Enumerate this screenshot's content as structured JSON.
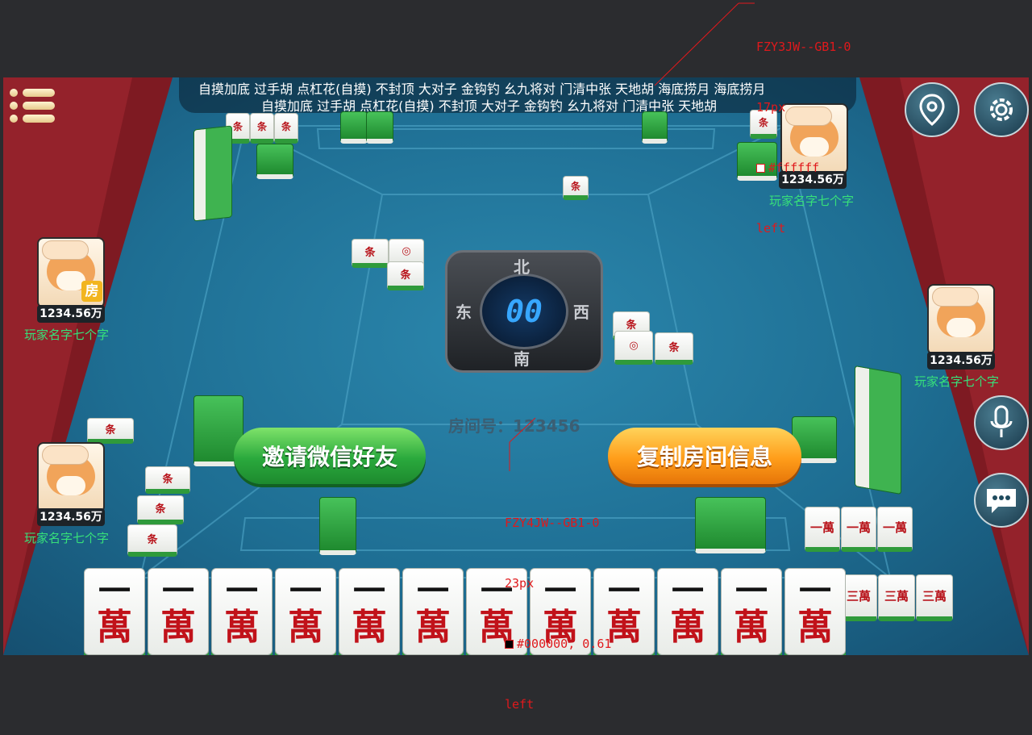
{
  "annotations": {
    "top": {
      "lines": [
        "FZY3JW--GB1-0",
        "17px",
        "#ffffff",
        "left"
      ],
      "swatch": "#ffffff"
    },
    "room": {
      "lines": [
        "FZY4JW--GB1-0",
        "23px",
        "#000000, 0.61",
        "left"
      ],
      "swatch": "#000000"
    }
  },
  "rules": {
    "line1": "自摸加底  过手胡  点杠花(自摸)  不封顶  大对子  金钩钓  幺九将对  门清中张  天地胡  海底捞月  海底捞月",
    "line2": "自摸加底  过手胡  点杠花(自摸)  不封顶  大对子  金钩钓  幺九将对  门清中张  天地胡"
  },
  "players": {
    "top_right": {
      "money": "1234.56万",
      "name": "玩家名字七个字"
    },
    "left": {
      "money": "1234.56万",
      "name": "玩家名字七个字",
      "badge": "房"
    },
    "right": {
      "money": "1234.56万",
      "name": "玩家名字七个字"
    },
    "bottom_left": {
      "money": "1234.56万",
      "name": "玩家名字七个字"
    }
  },
  "compass": {
    "timer": "00",
    "north": "北",
    "east": "东",
    "south": "南",
    "west": "西"
  },
  "room": {
    "label": "房间号：123456"
  },
  "buttons": {
    "invite": "邀请微信好友",
    "copy": "复制房间信息"
  },
  "hand": {
    "tiles": [
      {
        "n": "一",
        "w": "萬"
      },
      {
        "n": "一",
        "w": "萬"
      },
      {
        "n": "一",
        "w": "萬"
      },
      {
        "n": "一",
        "w": "萬"
      },
      {
        "n": "一",
        "w": "萬"
      },
      {
        "n": "一",
        "w": "萬"
      },
      {
        "n": "一",
        "w": "萬"
      },
      {
        "n": "一",
        "w": "萬"
      },
      {
        "n": "一",
        "w": "萬"
      },
      {
        "n": "一",
        "w": "萬"
      },
      {
        "n": "一",
        "w": "萬"
      },
      {
        "n": "一",
        "w": "萬"
      }
    ]
  },
  "melds": {
    "right_row1": [
      "一萬",
      "一萬",
      "一萬"
    ],
    "right_row2": [
      "三萬",
      "三萬",
      "三萬"
    ]
  },
  "icons": {
    "menu": "menu-icon",
    "location": "location-pin-icon",
    "settings": "gear-icon",
    "voice": "microphone-icon",
    "chat": "chat-bubble-icon"
  },
  "colors": {
    "felt": "#1e6e93",
    "rail": "#7e1a22",
    "player_name": "#37e07a",
    "annotation": "#e0191c",
    "timer": "#37a7ff"
  }
}
